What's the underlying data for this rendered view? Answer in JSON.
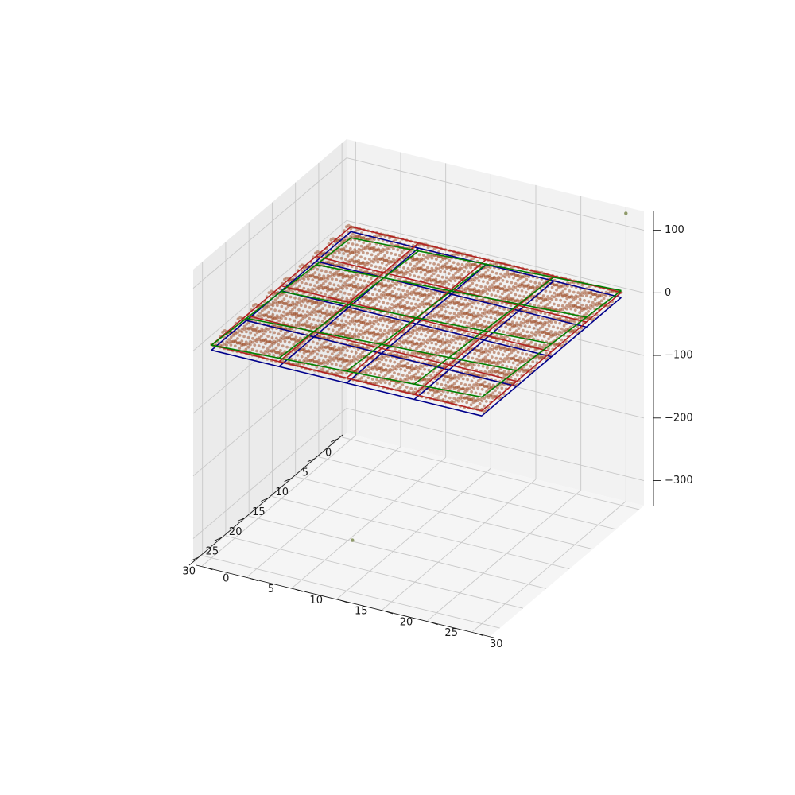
{
  "chart_data": {
    "type": "scatter",
    "projection": "3d",
    "title": "",
    "xlabel": "",
    "ylabel": "",
    "zlabel": "",
    "xlim": [
      -1,
      32
    ],
    "ylim": [
      -1,
      32
    ],
    "zlim": [
      -340,
      130
    ],
    "grid": true,
    "x_ticks": [
      0,
      5,
      10,
      15,
      20,
      25,
      30
    ],
    "y_ticks": [
      0,
      5,
      10,
      15,
      20,
      25,
      30
    ],
    "z_ticks": [
      100,
      0,
      -100,
      -200,
      -300
    ],
    "x_tick_labels": [
      "0",
      "5",
      "10",
      "15",
      "20",
      "25",
      "30"
    ],
    "y_tick_labels": [
      "0",
      "5",
      "10",
      "15",
      "20",
      "25",
      "30"
    ],
    "z_tick_labels": [
      "100",
      "0",
      "−100",
      "−200",
      "−300"
    ],
    "colors": {
      "points": "#a0522d",
      "outliers": "#8f9a6a",
      "plane_blue": "#00008b",
      "plane_red": "#b22222",
      "plane_green": "#008000",
      "pane_left": "#ebebeb",
      "pane_right": "#f2f2f2",
      "pane_floor": "#f5f5f5",
      "grid": "#c8c8c8"
    },
    "point_grid": {
      "x_range": [
        0,
        30
      ],
      "y_range": [
        0,
        30
      ],
      "count_per_axis": 64,
      "z_base": 0,
      "z_amplitude": 6
    },
    "outliers": [
      {
        "x": -1,
        "y": 30,
        "z": 120
      },
      {
        "x": 21,
        "y": 11,
        "z": -330
      }
    ],
    "planes": [
      {
        "name": "",
        "color": "#00008b",
        "corners_z": [
          -8,
          -8,
          -8,
          -8
        ],
        "cells": 4
      },
      {
        "name": "",
        "color": "#b22222",
        "corners_z": [
          0,
          0,
          0,
          0
        ],
        "cells": 4
      },
      {
        "name": "",
        "color": "#008000",
        "corners_z": [
          -18,
          0,
          22,
          3
        ],
        "cells": 4
      }
    ]
  }
}
